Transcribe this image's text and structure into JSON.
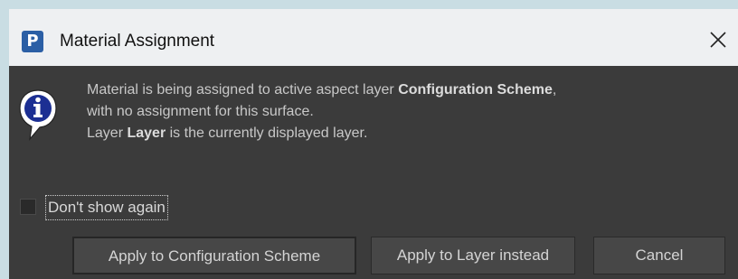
{
  "window": {
    "app_icon_letter": "P",
    "title": "Material Assignment"
  },
  "message": {
    "line1_pre": "Material is being assigned to active aspect layer ",
    "line1_bold": "Configuration Scheme",
    "line1_post": ",",
    "line2": "with no assignment for this surface.",
    "line3_pre": "Layer ",
    "line3_bold": "Layer",
    "line3_post": " is the currently displayed layer."
  },
  "checkbox": {
    "label": "Don't show again",
    "checked": false
  },
  "buttons": {
    "apply_config": "Apply to Configuration Scheme",
    "apply_layer": "Apply to Layer instead",
    "cancel": "Cancel"
  },
  "icons": {
    "app": "app-logo-icon",
    "info": "info-icon",
    "close": "close-icon"
  },
  "colors": {
    "dialog_bg": "#3b3b3b",
    "titlebar_bg": "#eef0f2",
    "page_bg": "#c9dde3",
    "app_icon": "#2b5fa5",
    "info_icon": "#1c2f93"
  }
}
